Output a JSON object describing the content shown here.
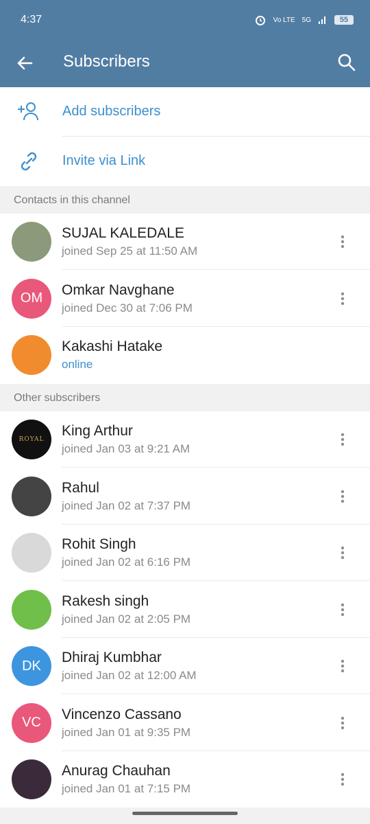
{
  "status_bar": {
    "time": "4:37",
    "network": "Vo LTE",
    "signal": "5G",
    "battery": "55"
  },
  "app_bar": {
    "title": "Subscribers",
    "back_icon": "arrow-left-icon",
    "search_icon": "search-icon"
  },
  "actions": [
    {
      "label": "Add subscribers",
      "icon": "add-person-icon"
    },
    {
      "label": "Invite via Link",
      "icon": "link-icon"
    }
  ],
  "sections": {
    "contacts": {
      "header": "Contacts in this channel",
      "items": [
        {
          "name": "SUJAL KALEDALE",
          "status": "joined Sep 25 at 11:50 AM",
          "initials": "",
          "color": "#8a9a7a"
        },
        {
          "name": "Omkar Navghane",
          "status": "joined Dec 30 at 7:06 PM",
          "initials": "OM",
          "color": "#e9587a"
        },
        {
          "name": "Kakashi Hatake",
          "status": "online",
          "initials": "",
          "color": "#f08c2e"
        }
      ]
    },
    "others": {
      "header": "Other subscribers",
      "items": [
        {
          "name": "King Arthur",
          "status": "joined Jan 03 at 9:21 AM",
          "initials": "",
          "color": "#111111"
        },
        {
          "name": "Rahul",
          "status": "joined Jan 02 at 7:37 PM",
          "initials": "",
          "color": "#444444"
        },
        {
          "name": "Rohit Singh",
          "status": "joined Jan 02 at 6:16 PM",
          "initials": "",
          "color": "#d9d9d9"
        },
        {
          "name": "Rakesh singh",
          "status": "joined Jan 02 at 2:05 PM",
          "initials": "",
          "color": "#6fbf4a"
        },
        {
          "name": "Dhiraj Kumbhar",
          "status": "joined Jan 02 at 12:00 AM",
          "initials": "DK",
          "color": "#3d95e0"
        },
        {
          "name": "Vincenzo Cassano",
          "status": "joined Jan 01 at 9:35 PM",
          "initials": "VC",
          "color": "#e9587a"
        },
        {
          "name": "Anurag Chauhan",
          "status": "joined Jan 01 at 7:15 PM",
          "initials": "",
          "color": "#3a2a3a"
        }
      ]
    }
  },
  "colors": {
    "header": "#527da3",
    "accent": "#3b8fd0"
  },
  "avatar_logo_text": "ROYAL"
}
